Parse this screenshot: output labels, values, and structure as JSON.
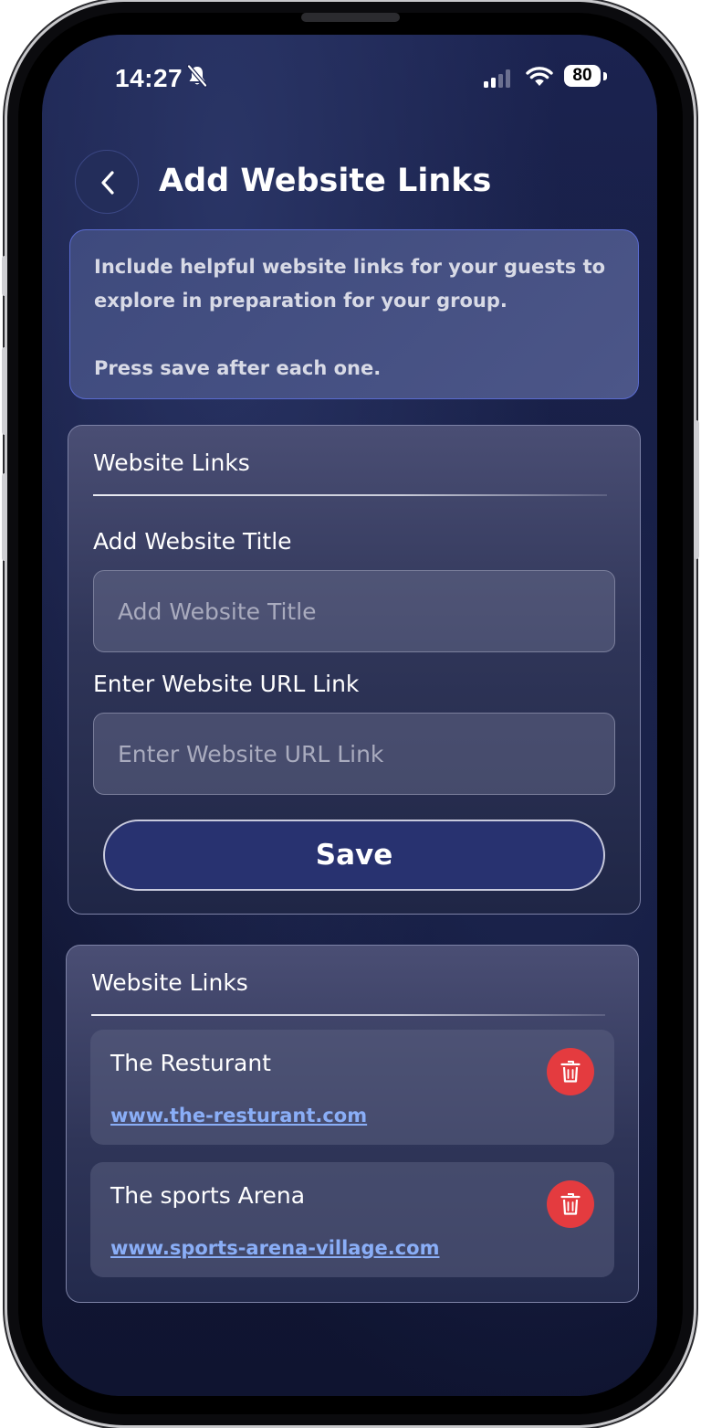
{
  "status_bar": {
    "time": "14:27",
    "battery": "80"
  },
  "header": {
    "title": "Add Website Links",
    "back_icon": "chevron-left-icon"
  },
  "info": {
    "line1": "Include helpful website links for your guests to explore in preparation for your group.",
    "line2": "Press save after each one."
  },
  "form": {
    "heading": "Website Links",
    "title_label": "Add Website Title",
    "title_value": "",
    "title_placeholder": "Add Website Title",
    "url_label": "Enter Website URL Link",
    "url_value": "",
    "url_placeholder": "Enter Website URL Link",
    "save_label": "Save"
  },
  "links_list": {
    "heading": "Website Links",
    "items": [
      {
        "title": "The Resturant",
        "url": "www.the-resturant.com"
      },
      {
        "title": "The sports Arena",
        "url": "www.sports-arena-village.com"
      }
    ]
  },
  "colors": {
    "accent": "#283270",
    "link": "#8aaef7",
    "delete": "#e43b3f",
    "info_border": "#5a6bd0"
  }
}
